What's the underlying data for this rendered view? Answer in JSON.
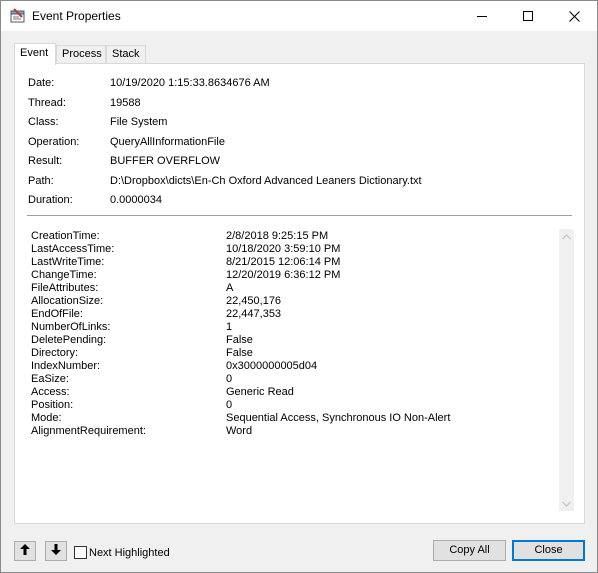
{
  "window": {
    "title": "Event Properties"
  },
  "tabs": [
    {
      "label": "Event",
      "active": true
    },
    {
      "label": "Process",
      "active": false
    },
    {
      "label": "Stack",
      "active": false
    }
  ],
  "event": {
    "date_label": "Date:",
    "date_value": "10/19/2020 1:15:33.8634676 AM",
    "thread_label": "Thread:",
    "thread_value": "19588",
    "class_label": "Class:",
    "class_value": "File System",
    "operation_label": "Operation:",
    "operation_value": "QueryAllInformationFile",
    "result_label": "Result:",
    "result_value": "BUFFER OVERFLOW",
    "path_label": "Path:",
    "path_value": "D:\\Dropbox\\dicts\\En-Ch Oxford Advanced Leaners Dictionary.txt",
    "duration_label": "Duration:",
    "duration_value": "0.0000034"
  },
  "details": [
    {
      "key": "CreationTime:",
      "value": "2/8/2018 9:25:15 PM"
    },
    {
      "key": "LastAccessTime:",
      "value": "10/18/2020 3:59:10 PM"
    },
    {
      "key": "LastWriteTime:",
      "value": "8/21/2015 12:06:14 PM"
    },
    {
      "key": "ChangeTime:",
      "value": "12/20/2019 6:36:12 PM"
    },
    {
      "key": "FileAttributes:",
      "value": "A"
    },
    {
      "key": "AllocationSize:",
      "value": "22,450,176"
    },
    {
      "key": "EndOfFile:",
      "value": "22,447,353"
    },
    {
      "key": "NumberOfLinks:",
      "value": "1"
    },
    {
      "key": "DeletePending:",
      "value": "False"
    },
    {
      "key": "Directory:",
      "value": "False"
    },
    {
      "key": "IndexNumber:",
      "value": "0x3000000005d04"
    },
    {
      "key": "EaSize:",
      "value": "0"
    },
    {
      "key": "Access:",
      "value": "Generic Read"
    },
    {
      "key": "Position:",
      "value": "0"
    },
    {
      "key": "Mode:",
      "value": "Sequential Access, Synchronous IO Non-Alert"
    },
    {
      "key": "AlignmentRequirement:",
      "value": "Word"
    }
  ],
  "footer": {
    "next_highlighted_label": "Next Highlighted",
    "next_highlighted_checked": false,
    "copy_all_label": "Copy All",
    "close_label": "Close"
  },
  "icons": {
    "app": "event-properties-icon",
    "minimize": "minimize-icon",
    "maximize": "maximize-icon",
    "close": "close-icon",
    "up": "arrow-up-icon",
    "down": "arrow-down-icon",
    "scroll_up": "scroll-up-icon",
    "scroll_down": "scroll-down-icon"
  },
  "colors": {
    "accent": "#0078d7",
    "window_bg": "#f0f0f0",
    "panel_bg": "#ffffff"
  }
}
